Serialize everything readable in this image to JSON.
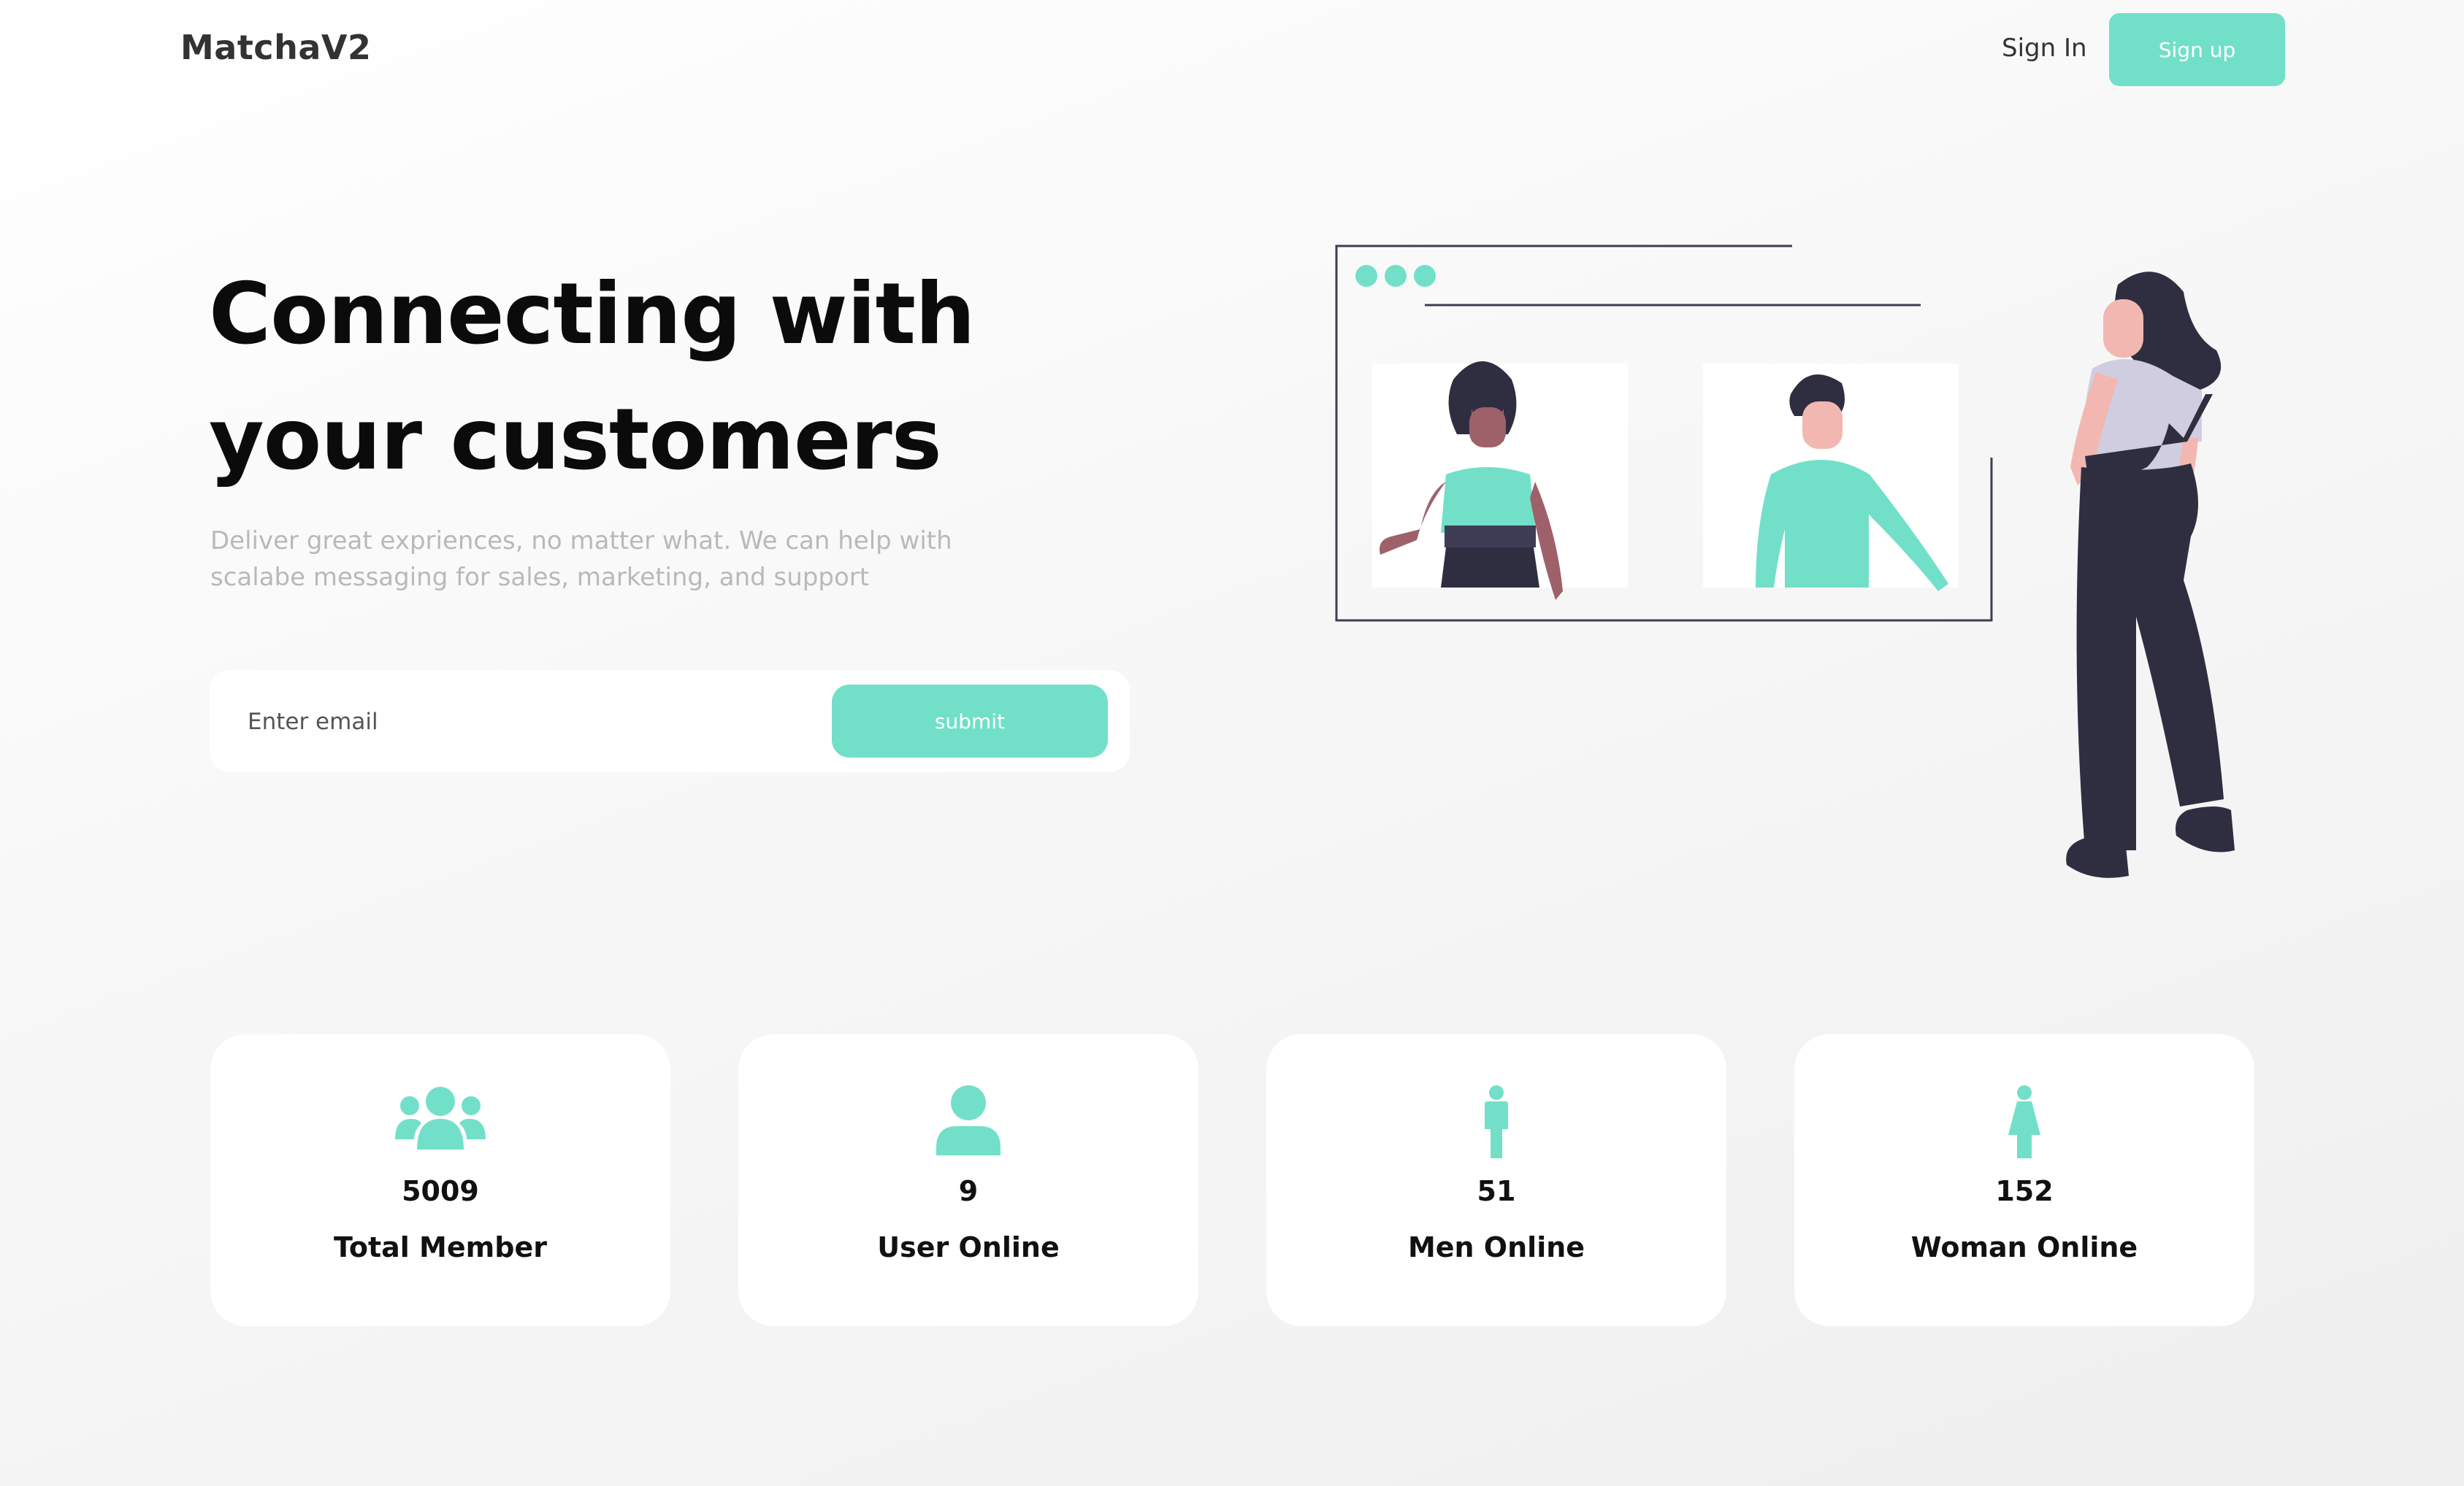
{
  "nav": {
    "logo": "MatchaV2",
    "sign_in": "Sign In",
    "sign_up": "Sign up"
  },
  "hero": {
    "title": "Connecting with your customers",
    "subtitle": "Deliver great expriences, no matter what. We can help with scalabe messaging for sales, marketing, and support"
  },
  "email_form": {
    "placeholder": "Enter email",
    "submit_label": "submit"
  },
  "stats": [
    {
      "icon": "users-group-icon",
      "value": "5009",
      "label": "Total Member"
    },
    {
      "icon": "user-icon",
      "value": "9",
      "label": "User Online"
    },
    {
      "icon": "male-icon",
      "value": "51",
      "label": "Men Online"
    },
    {
      "icon": "female-icon",
      "value": "152",
      "label": "Woman Online"
    }
  ],
  "colors": {
    "accent": "#72e0c8",
    "dark": "#2f2e41",
    "skin": "#f2b7b0"
  }
}
